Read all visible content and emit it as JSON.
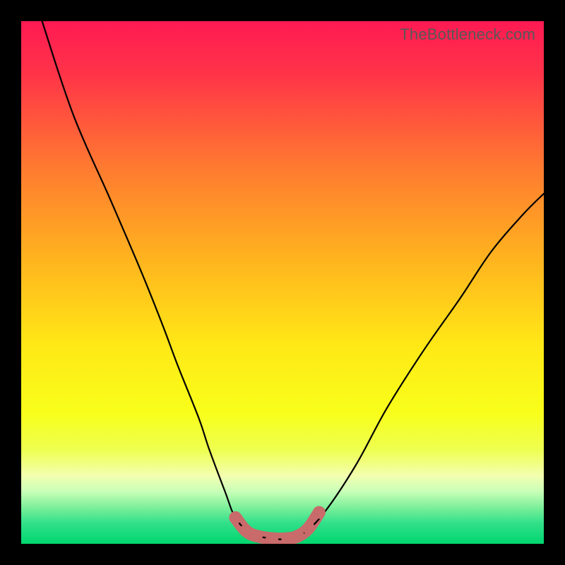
{
  "watermark": "TheBottleneck.com",
  "chart_data": {
    "type": "line",
    "title": "",
    "xlabel": "",
    "ylabel": "",
    "xlim": [
      0,
      100
    ],
    "ylim": [
      0,
      100
    ],
    "series": [
      {
        "name": "bottleneck-curve",
        "x": [
          4,
          10,
          17,
          23,
          27,
          30,
          34,
          36,
          39,
          41,
          44,
          48,
          51,
          54,
          58,
          64,
          70,
          77,
          84,
          90,
          96,
          100
        ],
        "values": [
          100,
          82,
          66,
          52,
          42,
          34,
          24,
          18,
          10,
          5,
          2,
          1,
          1,
          2,
          6,
          15,
          26,
          37,
          47,
          56,
          63,
          67
        ]
      }
    ],
    "highlight_segment": {
      "name": "valley-highlight",
      "x": [
        41,
        43,
        45,
        48,
        51,
        53,
        55,
        57
      ],
      "values": [
        5,
        2.5,
        1.5,
        1,
        1,
        1.5,
        3,
        6
      ]
    },
    "gradient_stops": [
      {
        "offset": 0.0,
        "color": "#ff1a53"
      },
      {
        "offset": 0.1,
        "color": "#ff3348"
      },
      {
        "offset": 0.28,
        "color": "#ff7a30"
      },
      {
        "offset": 0.45,
        "color": "#ffb21f"
      },
      {
        "offset": 0.62,
        "color": "#ffe816"
      },
      {
        "offset": 0.75,
        "color": "#f8ff1a"
      },
      {
        "offset": 0.82,
        "color": "#eeff50"
      },
      {
        "offset": 0.87,
        "color": "#f3ffb0"
      },
      {
        "offset": 0.9,
        "color": "#c8ffb8"
      },
      {
        "offset": 0.93,
        "color": "#7df09a"
      },
      {
        "offset": 0.96,
        "color": "#32e08a"
      },
      {
        "offset": 1.0,
        "color": "#00d66f"
      }
    ]
  }
}
